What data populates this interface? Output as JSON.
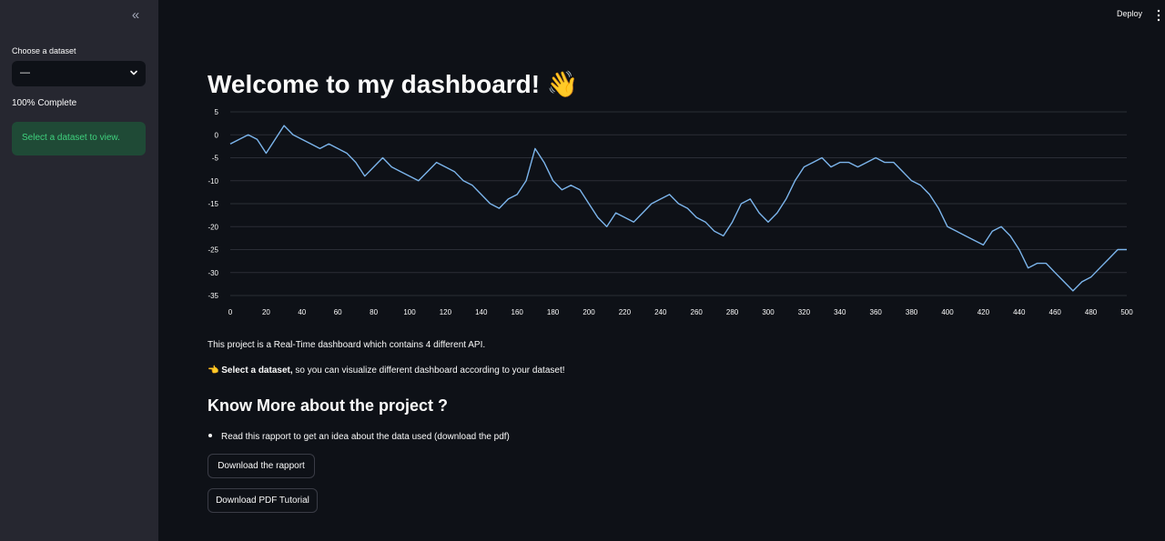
{
  "sidebar": {
    "collapse_glyph": "«",
    "select_label": "Choose a dataset",
    "select_value": "—",
    "progress_text": "100% Complete",
    "alert_text": "Select a dataset to view."
  },
  "header": {
    "deploy_label": "Deploy"
  },
  "main": {
    "title": "Welcome to my dashboard! 👋",
    "para1": "This project is a Real-Time dashboard which contains 4 different API.",
    "para2_icon": "👈",
    "para2_bold": "Select a dataset,",
    "para2_rest": " so you can visualize different dashboard according to your dataset!",
    "subheading": "Know More about the project ?",
    "bullet": "Read this rapport to get an idea about the data used (download the pdf)",
    "download_rapport_label": "Download the rapport",
    "download_tutorial_label": "Download PDF Tutorial"
  },
  "colors": {
    "line": "#7cb5ec",
    "grid": "#2b2e36",
    "success_text": "#3fd07d",
    "success_bg": "#1f4a36"
  },
  "chart_data": {
    "type": "line",
    "xlim": [
      0,
      500
    ],
    "ylim": [
      -35,
      5
    ],
    "x_ticks": [
      0,
      20,
      40,
      60,
      80,
      100,
      120,
      140,
      160,
      180,
      200,
      220,
      240,
      260,
      280,
      300,
      320,
      340,
      360,
      380,
      400,
      420,
      440,
      460,
      480,
      500
    ],
    "y_ticks": [
      5,
      0,
      -5,
      -10,
      -15,
      -20,
      -25,
      -30,
      -35
    ],
    "grid": true,
    "series": [
      {
        "x": [
          0,
          5,
          10,
          15,
          20,
          25,
          30,
          35,
          40,
          45,
          50,
          55,
          60,
          65,
          70,
          75,
          80,
          85,
          90,
          95,
          100,
          105,
          110,
          115,
          120,
          125,
          130,
          135,
          140,
          145,
          150,
          155,
          160,
          165,
          170,
          175,
          180,
          185,
          190,
          195,
          200,
          205,
          210,
          215,
          220,
          225,
          230,
          235,
          240,
          245,
          250,
          255,
          260,
          265,
          270,
          275,
          280,
          285,
          290,
          295,
          300,
          305,
          310,
          315,
          320,
          325,
          330,
          335,
          340,
          345,
          350,
          355,
          360,
          365,
          370,
          375,
          380,
          385,
          390,
          395,
          400,
          405,
          410,
          415,
          420,
          425,
          430,
          435,
          440,
          445,
          450,
          455,
          460,
          465,
          470,
          475,
          480,
          485,
          490,
          495,
          500
        ],
        "values": [
          -2,
          -1,
          0,
          -1,
          -4,
          -1,
          2,
          0,
          -1,
          -2,
          -3,
          -2,
          -3,
          -4,
          -6,
          -9,
          -7,
          -5,
          -7,
          -8,
          -9,
          -10,
          -8,
          -6,
          -7,
          -8,
          -10,
          -11,
          -13,
          -15,
          -16,
          -14,
          -13,
          -10,
          -3,
          -6,
          -10,
          -12,
          -11,
          -12,
          -15,
          -18,
          -20,
          -17,
          -18,
          -19,
          -17,
          -15,
          -14,
          -13,
          -15,
          -16,
          -18,
          -19,
          -21,
          -22,
          -19,
          -15,
          -14,
          -17,
          -19,
          -17,
          -14,
          -10,
          -7,
          -6,
          -5,
          -7,
          -6,
          -6,
          -7,
          -6,
          -5,
          -6,
          -6,
          -8,
          -10,
          -11,
          -13,
          -16,
          -20,
          -21,
          -22,
          -23,
          -24,
          -21,
          -20,
          -22,
          -25,
          -29,
          -28,
          -28,
          -30,
          -32,
          -34,
          -32,
          -31,
          -29,
          -27,
          -25,
          -25
        ]
      }
    ]
  }
}
